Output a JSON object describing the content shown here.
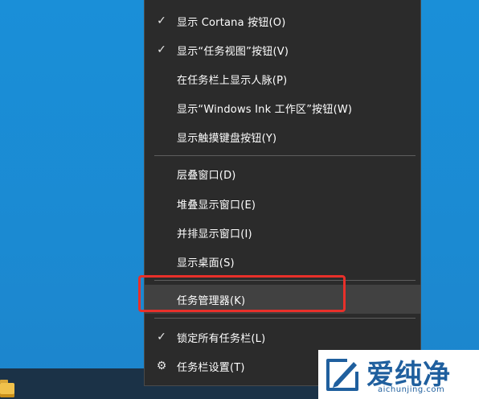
{
  "menu": {
    "items": [
      {
        "label": "显示 Cortana 按钮(O)",
        "mark": "✓"
      },
      {
        "label": "显示“任务视图”按钮(V)",
        "mark": "✓"
      },
      {
        "label": "在任务栏上显示人脉(P)",
        "mark": ""
      },
      {
        "label": "显示“Windows Ink 工作区”按钮(W)",
        "mark": ""
      },
      {
        "label": "显示触摸键盘按钮(Y)",
        "mark": ""
      },
      {
        "label": "层叠窗口(D)",
        "mark": ""
      },
      {
        "label": "堆叠显示窗口(E)",
        "mark": ""
      },
      {
        "label": "并排显示窗口(I)",
        "mark": ""
      },
      {
        "label": "显示桌面(S)",
        "mark": ""
      },
      {
        "label": "任务管理器(K)",
        "mark": ""
      },
      {
        "label": "锁定所有任务栏(L)",
        "mark": "✓"
      },
      {
        "label": "任务栏设置(T)",
        "mark": "⚙"
      }
    ]
  },
  "watermark": {
    "brand": "爱纯净",
    "domain": "aichunjing.com"
  },
  "colors": {
    "desktop": "#1a8fd8",
    "menu_bg": "#2b2b2b",
    "highlight": "#414141",
    "annotation": "#e8302a"
  }
}
